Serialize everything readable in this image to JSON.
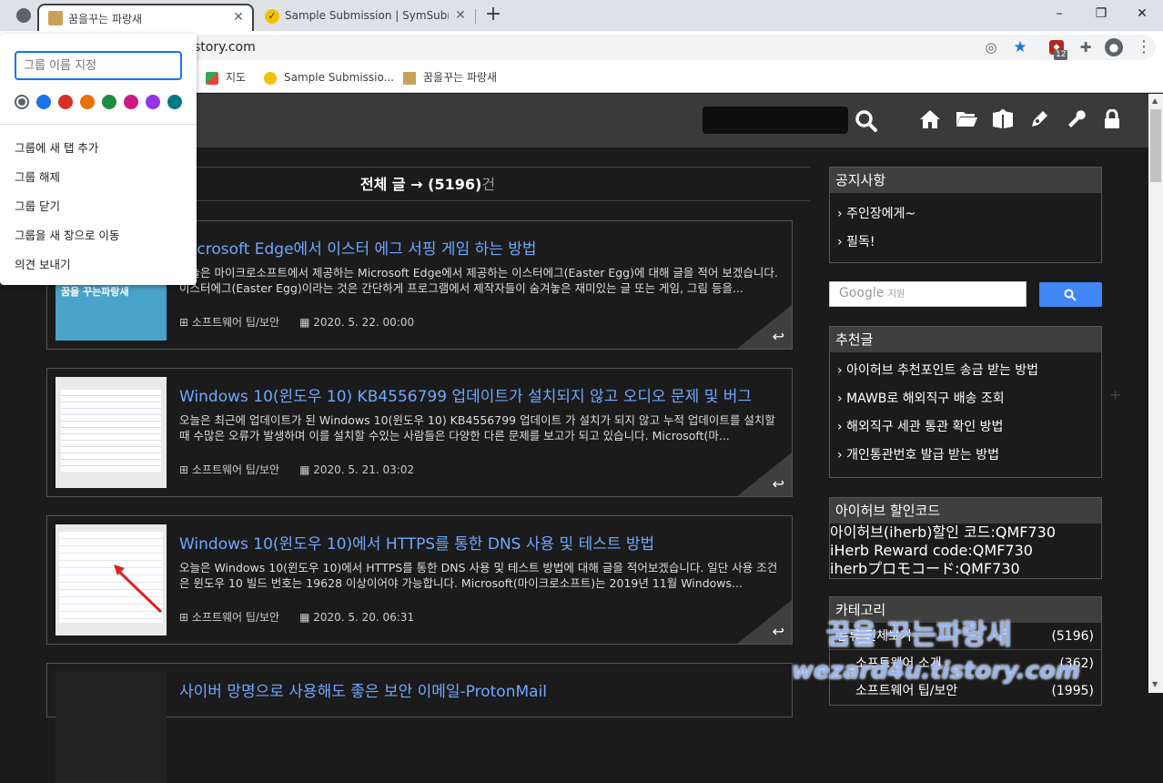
{
  "browser": {
    "tabs": [
      {
        "title": "꿈을꾸는 파랑새",
        "active": true
      },
      {
        "title": "Sample Submission | SymSubmi",
        "active": false
      }
    ],
    "new_tab": "+",
    "window": {
      "minimize": "–",
      "restore": "❐",
      "close": "✕"
    },
    "url": "story.com",
    "ext_badge": "12",
    "bookmarks": [
      {
        "label": "지도"
      },
      {
        "label": "Sample Submissio..."
      },
      {
        "label": "꿈을꾸는 파랑새"
      }
    ]
  },
  "tab_group_popup": {
    "name_placeholder": "그룹 이름 지정",
    "colors": [
      "#5f6368",
      "#1a73e8",
      "#d93025",
      "#e8710a",
      "#1e8e3e",
      "#d01884",
      "#9334e6",
      "#007b83"
    ],
    "items": [
      "그룹에 새 탭 추가",
      "그룹 해제",
      "그룹 닫기",
      "그룹을 새 창으로 이동",
      "의견 보내기"
    ]
  },
  "site": {
    "list_title": "전체 글 → (5196)",
    "list_unit": "건",
    "posts": [
      {
        "title": "Microsoft Edge에서 이스터 에그 서핑 게임 하는 방법",
        "excerpt": "오늘은 마이크로소프트에서 제공하는 Microsoft Edge에서 제공하는 이스터에그(Easter Egg)에 대해 글을 적어 보겠습니다. 이스터에그(Easter Egg)이라는 것은 간단하게 프로그램에서 제작자들이 숨겨놓은 재미있는 글 또는 게임, 그림 등을...",
        "category": "소프트웨어 팁/보안",
        "date": "2020. 5. 22. 00:00"
      },
      {
        "title": "Windows 10(윈도우 10) KB4556799 업데이트가 설치되지 않고 오디오 문제 및 버그",
        "excerpt": "오늘은 최근에 업데이트가 된 Windows 10(윈도우 10) KB4556799 업데이트 가 설치가 되지 않고 누적 업데이트를 설치할 때 수많은 오류가 발생하며 이를 설치할 수있는 사람들은 다양한 다른 문제를 보고가 되고 있습니다. Microsoft(마...",
        "category": "소프트웨어 팁/보안",
        "date": "2020. 5. 21. 03:02"
      },
      {
        "title": "Windows 10(윈도우 10)에서 HTTPS를 통한 DNS 사용 및 테스트 방법",
        "excerpt": "오늘은 Windows 10(윈도우 10)에서 HTTPS를 통한 DNS 사용 및 테스트 방법에 대해 글을 적어보겠습니다. 일단 사용 조건은 윈도우 10 빌드 번호는 19628 이상이어야 가능합니다. Microsoft(마이크로소프트)는 2019년 11월 Windows...",
        "category": "소프트웨어 팁/보안",
        "date": "2020. 5. 20. 06:31"
      },
      {
        "title": "사이버 망명으로 사용해도 좋은 보안 이메일-ProtonMail",
        "excerpt": "",
        "category": "",
        "date": ""
      }
    ],
    "sidebar": {
      "notice_title": "공지사항",
      "notice_items": [
        "주인장에게~",
        "필독!"
      ],
      "google_label": "Google",
      "google_sub": "지원",
      "recommend_title": "추천글",
      "recommend_items": [
        "아이허브 추천포인트 송금 받는 방법",
        "MAWB로 해외직구 배송 조회",
        "해외직구 세관 통관 확인 방법",
        "개인통관번호 발급 받는 방법"
      ],
      "iherb_title": "아이허브 할인코드",
      "iherb_lines": [
        "아이허브(iherb)할인 코드:QMF730",
        "iHerb Reward code:QMF730",
        "iherbプロモコード:QMF730"
      ],
      "category_title": "카테고리",
      "categories": [
        {
          "label": "분류 전체보기",
          "count": "(5196)"
        },
        {
          "label": "소프트웨어 소개",
          "count": "(362)"
        },
        {
          "label": "소프트웨어 팁/보안",
          "count": "(1995)"
        }
      ]
    },
    "watermark": {
      "line1": "꿈을 꾸는파랑새",
      "line2": "wezard4u.tistory.com"
    }
  }
}
